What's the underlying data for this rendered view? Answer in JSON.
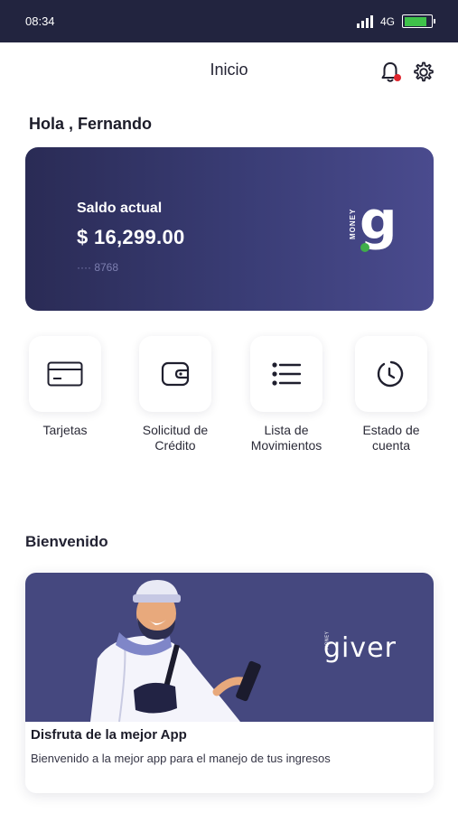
{
  "status_bar": {
    "time": "08:34",
    "network": "4G",
    "battery_level": 0.85,
    "battery_color": "#3fc24a"
  },
  "header": {
    "title": "Inicio",
    "notification_dot_color": "#e0262e"
  },
  "greeting": "Hola , Fernando",
  "balance_card": {
    "label": "Saldo actual",
    "amount": "$ 16,299.00",
    "card_number": "···· 8768",
    "logo_word": "MONEY",
    "logo_letter": "g"
  },
  "actions": [
    {
      "label": "Tarjetas",
      "icon": "credit-card-icon"
    },
    {
      "label": "Solicitud de\nCrédito",
      "icon": "wallet-icon"
    },
    {
      "label": "Lista de\nMovimientos",
      "icon": "list-icon"
    },
    {
      "label": "Estado de\ncuenta",
      "icon": "clock-icon"
    }
  ],
  "section_title": "Bienvenido",
  "promo": {
    "logo": "giver",
    "logo_small": "MONEY",
    "title": "Disfruta de la mejor App",
    "text": "Bienvenido a la mejor app para el manejo de tus ingresos"
  },
  "colors": {
    "brand_dark": "#22243f",
    "card_gradient_start": "#2a2b55",
    "card_gradient_end": "#4a4b8e",
    "banner": "#45487f"
  }
}
